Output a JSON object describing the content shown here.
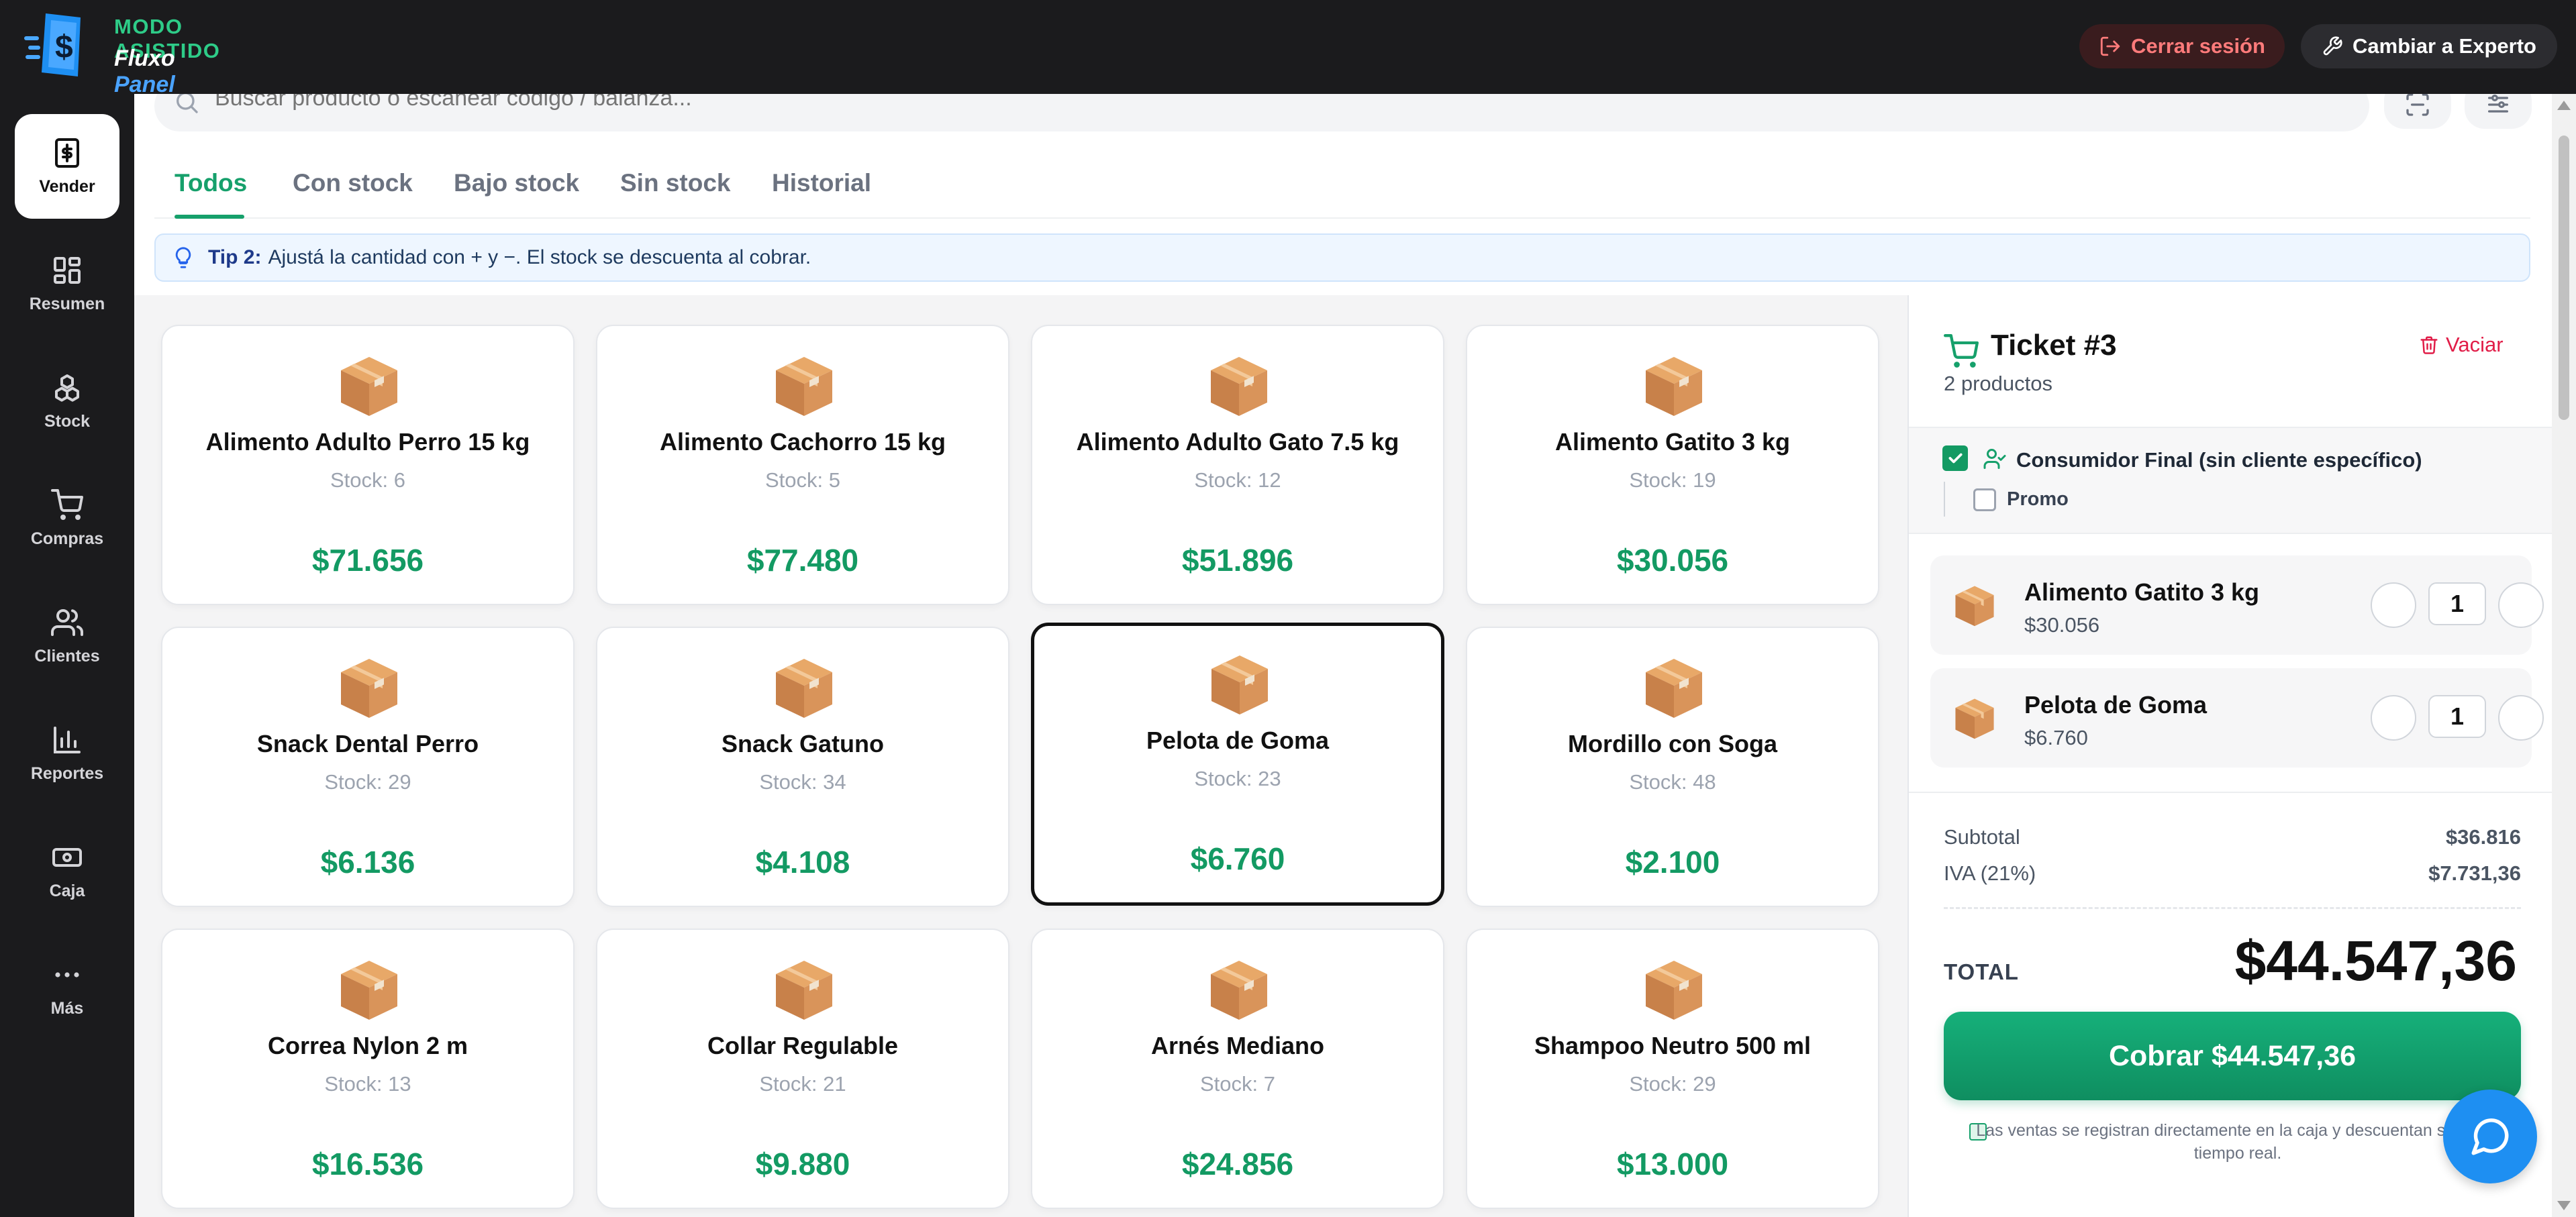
{
  "header": {
    "mode_label": "MODO ASISTIDO",
    "brand_part1": "Fluxo",
    "brand_part2": "Panel",
    "logout_label": "Cerrar sesión",
    "expert_label": "Cambiar a Experto"
  },
  "sidebar": {
    "items": [
      {
        "label": "Vender",
        "icon": "dollar-icon"
      },
      {
        "label": "Resumen",
        "icon": "grid-icon"
      },
      {
        "label": "Stock",
        "icon": "boxes-icon"
      },
      {
        "label": "Compras",
        "icon": "cart-icon"
      },
      {
        "label": "Clientes",
        "icon": "users-icon"
      },
      {
        "label": "Reportes",
        "icon": "bar-chart-icon"
      },
      {
        "label": "Caja",
        "icon": "cash-icon"
      },
      {
        "label": "Más",
        "icon": "more-icon"
      }
    ]
  },
  "search": {
    "placeholder": "Buscar producto o escanear código / balanza..."
  },
  "tabs": [
    "Todos",
    "Con stock",
    "Bajo stock",
    "Sin stock",
    "Historial"
  ],
  "tip": {
    "title": "Tip 2:",
    "text": "Ajustá la cantidad con + y −. El stock se descuenta al cobrar."
  },
  "products": [
    {
      "name": "Alimento Adulto Perro 15 kg",
      "stock": "Stock: 6",
      "price": "$71.656"
    },
    {
      "name": "Alimento Cachorro 15 kg",
      "stock": "Stock: 5",
      "price": "$77.480"
    },
    {
      "name": "Alimento Adulto Gato 7.5 kg",
      "stock": "Stock: 12",
      "price": "$51.896"
    },
    {
      "name": "Alimento Gatito 3 kg",
      "stock": "Stock: 19",
      "price": "$30.056"
    },
    {
      "name": "Snack Dental Perro",
      "stock": "Stock: 29",
      "price": "$6.136"
    },
    {
      "name": "Snack Gatuno",
      "stock": "Stock: 34",
      "price": "$4.108"
    },
    {
      "name": "Pelota de Goma",
      "stock": "Stock: 23",
      "price": "$6.760"
    },
    {
      "name": "Mordillo con Soga",
      "stock": "Stock: 48",
      "price": "$2.100"
    },
    {
      "name": "Correa Nylon 2 m",
      "stock": "Stock: 13",
      "price": "$16.536"
    },
    {
      "name": "Collar Regulable",
      "stock": "Stock: 21",
      "price": "$9.880"
    },
    {
      "name": "Arnés Mediano",
      "stock": "Stock: 7",
      "price": "$24.856"
    },
    {
      "name": "Shampoo Neutro 500 ml",
      "stock": "Stock: 29",
      "price": "$13.000"
    }
  ],
  "ticket": {
    "title": "Ticket #3",
    "count": "2 productos",
    "clear_label": "Vaciar",
    "customer_label": "Consumidor Final (sin cliente específico)",
    "promo_label": "Promo",
    "items": [
      {
        "name": "Alimento Gatito 3 kg",
        "price": "$30.056",
        "qty": "1"
      },
      {
        "name": "Pelota de Goma",
        "price": "$6.760",
        "qty": "1"
      }
    ],
    "subtotal_label": "Subtotal",
    "subtotal_value": "$36.816",
    "iva_label": "IVA (21%)",
    "iva_value": "$7.731,36",
    "total_label": "TOTAL",
    "total_value": "$44.547,36",
    "pay_label": "Cobrar $44.547,36",
    "note": "Las ventas se registran directamente en la caja y descuentan stock en tiempo real."
  },
  "colors": {
    "accent_green": "#16a06b",
    "price_green": "#139a63",
    "dark_bg": "#1b1b1d",
    "danger": "#e11d48",
    "chat_blue": "#1e8ff2"
  }
}
